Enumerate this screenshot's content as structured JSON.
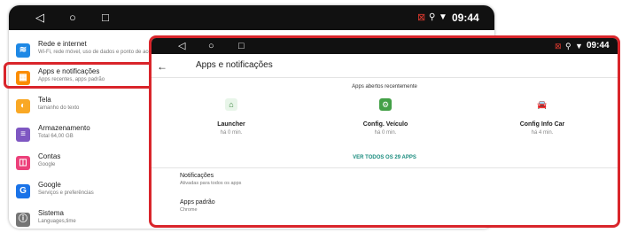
{
  "back_screen": {
    "nav": {
      "back": "◁",
      "home": "○",
      "recents": "□"
    },
    "time": "09:44",
    "items": [
      {
        "title": "Rede e internet",
        "subtitle": "Wi-Fi, rede móvel, uso de dados e ponto de acesso",
        "icon": "wifi-icon",
        "color": "#1e88e5",
        "glyph": "≋"
      },
      {
        "title": "Apps e notificações",
        "subtitle": "Apps recentes, apps padrão",
        "icon": "apps-grid-icon",
        "color": "#fb8c00",
        "glyph": "▦"
      },
      {
        "title": "Tela",
        "subtitle": "tamanho do texto",
        "icon": "display-icon",
        "color": "#f9a825",
        "glyph": "◐"
      },
      {
        "title": "Armazenamento",
        "subtitle": "Total 64,00 GB",
        "icon": "storage-icon",
        "color": "#7e57c2",
        "glyph": "≡"
      },
      {
        "title": "Contas",
        "subtitle": "Google",
        "icon": "accounts-icon",
        "color": "#ec407a",
        "glyph": "◫"
      },
      {
        "title": "Google",
        "subtitle": "Serviços e preferências",
        "icon": "google-icon",
        "color": "#1a73e8",
        "glyph": "G"
      },
      {
        "title": "Sistema",
        "subtitle": "Languages,time",
        "icon": "info-icon",
        "color": "#757575",
        "glyph": "ⓘ"
      }
    ]
  },
  "front_screen": {
    "nav": {
      "back": "◁",
      "home": "○",
      "recents": "□"
    },
    "time": "09:44",
    "back_arrow": "←",
    "title": "Apps e notificações",
    "recent_header": "Apps abertos recentemente",
    "recent_apps": [
      {
        "name": "Launcher",
        "time": "há 0 min.",
        "icon": "launcher-house-icon",
        "color": "#e8f5e9",
        "glyph": "⌂"
      },
      {
        "name": "Config. Veículo",
        "time": "há 0 min.",
        "icon": "vehicle-config-icon",
        "color": "#43a047",
        "glyph": "⚙"
      },
      {
        "name": "Config Info Car",
        "time": "há 4 min.",
        "icon": "car-icon",
        "color": "#ffffff",
        "glyph": "🚘"
      }
    ],
    "see_all": "VER TODOS OS 29 APPS",
    "items": [
      {
        "title": "Notificações",
        "subtitle": "Ativadas para todos os apps"
      },
      {
        "title": "Apps padrão",
        "subtitle": "Chrome"
      }
    ]
  },
  "status_icons": {
    "sim": "⊠",
    "location": "⚲",
    "wifi": "▼"
  },
  "colors": {
    "highlight": "#d9252b",
    "accent": "#1a8c7e",
    "status_bar": "#111111"
  }
}
